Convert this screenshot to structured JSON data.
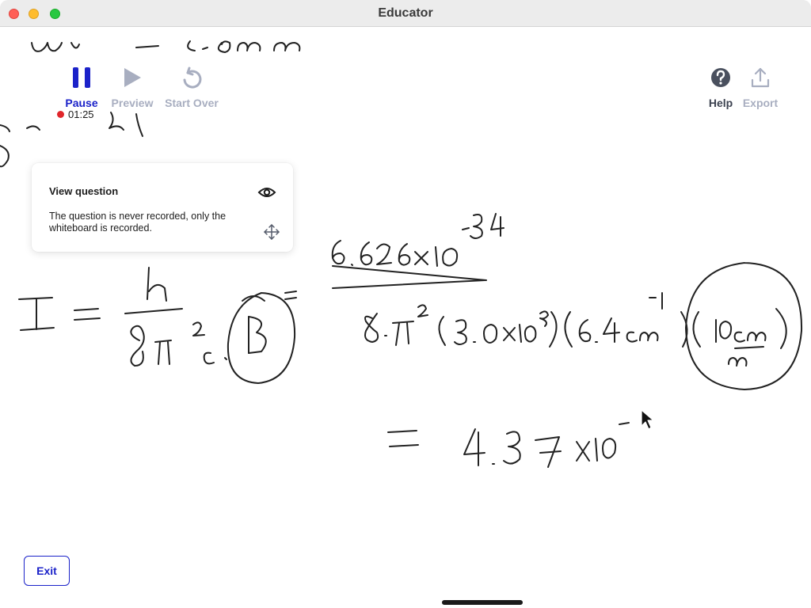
{
  "window": {
    "title": "Educator"
  },
  "toolbar": {
    "pause_label": "Pause",
    "preview_label": "Preview",
    "start_over_label": "Start Over",
    "help_label": "Help",
    "export_label": "Export",
    "timer": "01:25",
    "icons": {
      "pause": "pause-icon",
      "preview": "play-icon",
      "start_over": "restart-icon",
      "help": "help-icon",
      "export": "export-icon"
    },
    "colors": {
      "active": "#1b22c9",
      "disabled": "#a8aec0",
      "record": "#e0262b"
    }
  },
  "question_card": {
    "title": "View question",
    "body": "The question is never recorded, only the whiteboard is recorded."
  },
  "footer": {
    "exit_label": "Exit"
  },
  "whiteboard": {
    "handwriting": {
      "top_partial": "ω v = ν c̃ cm",
      "lhs": "I =",
      "frac_num": "h",
      "frac_den": "8π² c · B̃",
      "equals2": "=",
      "num": "6.626x10",
      "num_exp": "−34",
      "den": "8·π² (3.0x10⁸)(6.4cm⁻¹)(10cm/m)",
      "result": "= 4.37 x10⁻"
    }
  }
}
